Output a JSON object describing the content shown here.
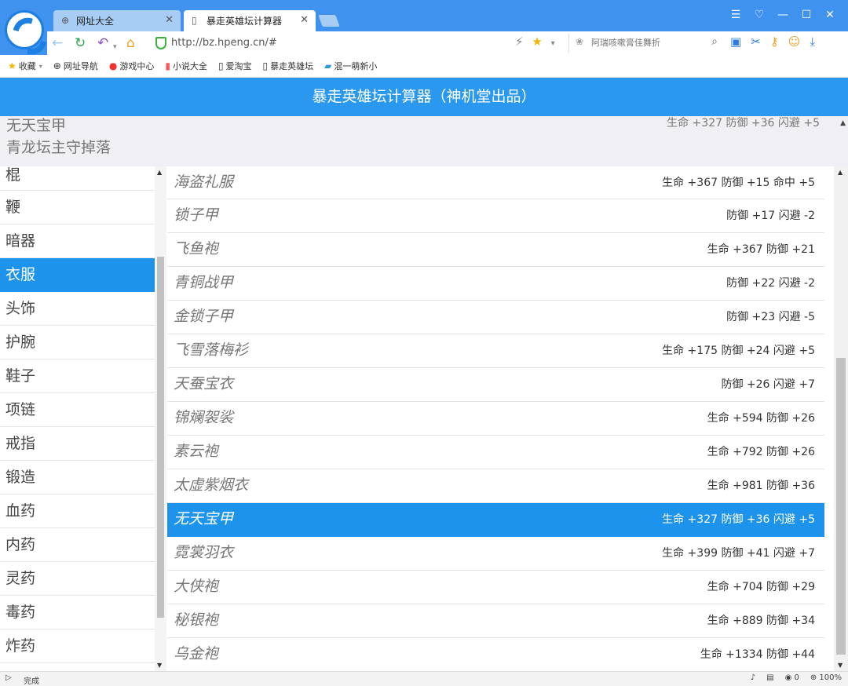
{
  "browser": {
    "tabs": [
      {
        "label": "网址大全",
        "active": false
      },
      {
        "label": "暴走英雄坛计算器",
        "active": true
      }
    ],
    "url": "http://bz.hpeng.cn/#",
    "search_placeholder": "阿瑞咳嗽膏佳舞折",
    "bookmarks": [
      "收藏",
      "网址导航",
      "游戏中心",
      "小说大全",
      "爱淘宝",
      "暴走英雄坛",
      "混一萌新小"
    ],
    "status_text": "完成",
    "status_count": "0",
    "zoom": "100%"
  },
  "page": {
    "title": "暴走英雄坛计算器（神机堂出品）"
  },
  "selected": {
    "name": "无天宝甲",
    "source": "青龙坛主守掉落",
    "stats": "生命 +327 防御 +36 闪避 +5"
  },
  "categories": [
    {
      "label": "棍",
      "active": false
    },
    {
      "label": "鞭",
      "active": false
    },
    {
      "label": "暗器",
      "active": false
    },
    {
      "label": "衣服",
      "active": true
    },
    {
      "label": "头饰",
      "active": false
    },
    {
      "label": "护腕",
      "active": false
    },
    {
      "label": "鞋子",
      "active": false
    },
    {
      "label": "项链",
      "active": false
    },
    {
      "label": "戒指",
      "active": false
    },
    {
      "label": "锻造",
      "active": false
    },
    {
      "label": "血药",
      "active": false
    },
    {
      "label": "内药",
      "active": false
    },
    {
      "label": "灵药",
      "active": false
    },
    {
      "label": "毒药",
      "active": false
    },
    {
      "label": "炸药",
      "active": false
    }
  ],
  "items": [
    {
      "name": "海盗礼服",
      "stats": "生命 +367 防御 +15 命中 +5",
      "active": false
    },
    {
      "name": "锁子甲",
      "stats": "防御 +17 闪避 -2",
      "active": false
    },
    {
      "name": "飞鱼袍",
      "stats": "生命 +367 防御 +21",
      "active": false
    },
    {
      "name": "青铜战甲",
      "stats": "防御 +22 闪避 -2",
      "active": false
    },
    {
      "name": "金锁子甲",
      "stats": "防御 +23 闪避 -5",
      "active": false
    },
    {
      "name": "飞雪落梅衫",
      "stats": "生命 +175 防御 +24 闪避 +5",
      "active": false
    },
    {
      "name": "天蚕宝衣",
      "stats": "防御 +26 闪避 +7",
      "active": false
    },
    {
      "name": "锦斓袈裟",
      "stats": "生命 +594 防御 +26",
      "active": false
    },
    {
      "name": "素云袍",
      "stats": "生命 +792 防御 +26",
      "active": false
    },
    {
      "name": "太虚紫烟衣",
      "stats": "生命 +981 防御 +36",
      "active": false
    },
    {
      "name": "无天宝甲",
      "stats": "生命 +327 防御 +36 闪避 +5",
      "active": true
    },
    {
      "name": "霓裳羽衣",
      "stats": "生命 +399 防御 +41 闪避 +7",
      "active": false
    },
    {
      "name": "大侠袍",
      "stats": "生命 +704 防御 +29",
      "active": false
    },
    {
      "name": "秘银袍",
      "stats": "生命 +889 防御 +34",
      "active": false
    },
    {
      "name": "乌金袍",
      "stats": "生命 +1334 防御 +44",
      "active": false
    }
  ]
}
